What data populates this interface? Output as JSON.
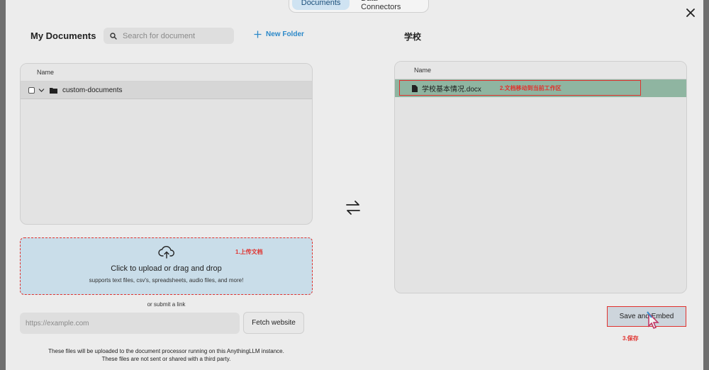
{
  "tabs": [
    {
      "label": "Documents",
      "active": true
    },
    {
      "label": "Data Connectors",
      "active": false
    }
  ],
  "left": {
    "title": "My Documents",
    "search_placeholder": "Search for document",
    "new_folder_label": "New Folder",
    "column_name": "Name",
    "folder_name": "custom-documents"
  },
  "upload": {
    "title": "Click to upload or drag and drop",
    "subtitle": "supports text files, csv's, spreadsheets, audio files, and more!",
    "annotation": "1.上传文档"
  },
  "link": {
    "or_text": "or submit a link",
    "placeholder": "https://example.com",
    "fetch_label": "Fetch website"
  },
  "disclaimer": {
    "line1": "These files will be uploaded to the document processor running on this AnythingLLM instance.",
    "line2": "These files are not sent or shared with a third party."
  },
  "right": {
    "title": "学校",
    "column_name": "Name",
    "file_name": "学校基本情况.docx",
    "file_annotation": "2.文档移动到当前工作区"
  },
  "save": {
    "label": "Save and Embed",
    "annotation": "3.保存"
  },
  "colors": {
    "accent": "#2c89c9",
    "annotation_red": "#e0322e",
    "selected_row": "#8fb5a1",
    "upload_bg": "#c9dde9"
  },
  "icons": [
    "close-icon",
    "search-icon",
    "plus-icon",
    "chevron-down-icon",
    "folder-icon",
    "file-icon",
    "swap-arrows-icon",
    "cloud-upload-icon",
    "pointer-cursor-icon"
  ]
}
